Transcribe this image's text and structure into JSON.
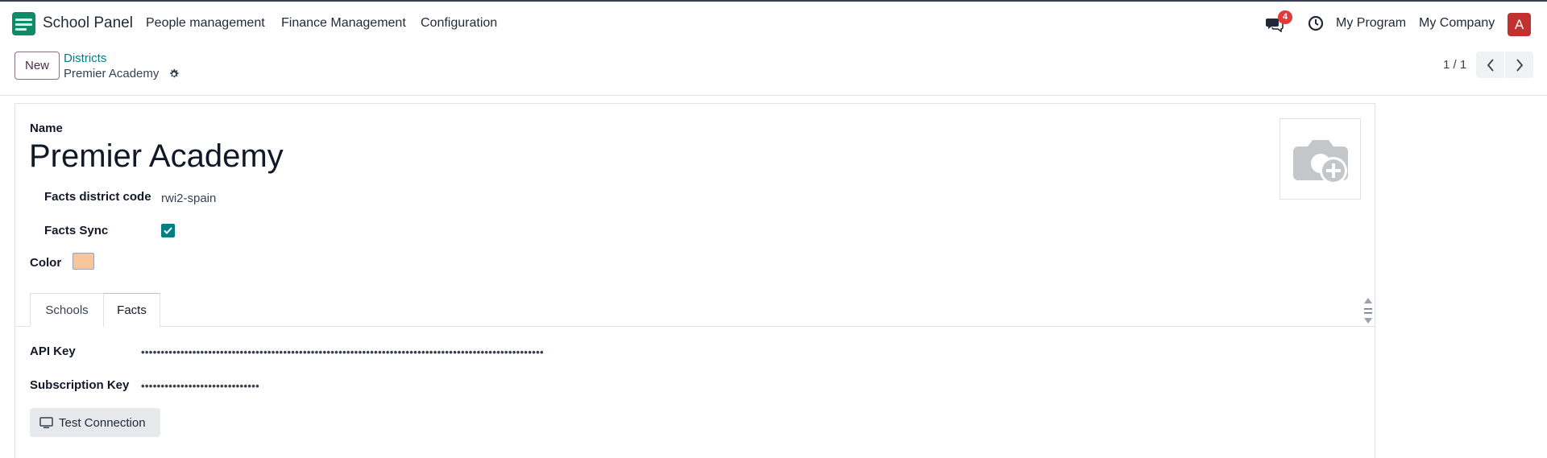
{
  "navbar": {
    "app_name": "School Panel",
    "menu": [
      "People management",
      "Finance Management",
      "Configuration"
    ],
    "messages_count": "4",
    "program": "My Program",
    "company": "My Company",
    "user_initial": "A"
  },
  "control": {
    "new_label": "New",
    "breadcrumb": "Districts",
    "record_title": "Premier Academy",
    "pager": "1 / 1"
  },
  "form": {
    "name_caption": "Name",
    "name_value": "Premier Academy",
    "district_code_label": "Facts district code",
    "district_code_value": "rwi2-spain",
    "sync_label": "Facts Sync",
    "sync_checked": true,
    "color_label": "Color",
    "color_value": "#f7c59a",
    "tabs": [
      "Schools",
      "Facts"
    ],
    "active_tab": "Facts",
    "api_key_label": "API Key",
    "api_key_value": "••••••••••••••••••••••••••••••••••••••••••••••••••••••••••••••••••••••••••••••••••••••••••••••••••••••",
    "subscription_key_label": "Subscription Key",
    "subscription_key_value": "••••••••••••••••••••••••••••••",
    "test_button": "Test Connection"
  },
  "colors": {
    "accent": "#017e84",
    "brand": "#714b67",
    "badge": "#e03a3a",
    "avatar": "#c0312f"
  },
  "icons": [
    "chat-icon",
    "clock-icon",
    "gear-icon",
    "chevron-left-icon",
    "chevron-right-icon",
    "camera-plus-icon",
    "check-icon",
    "monitor-icon"
  ]
}
